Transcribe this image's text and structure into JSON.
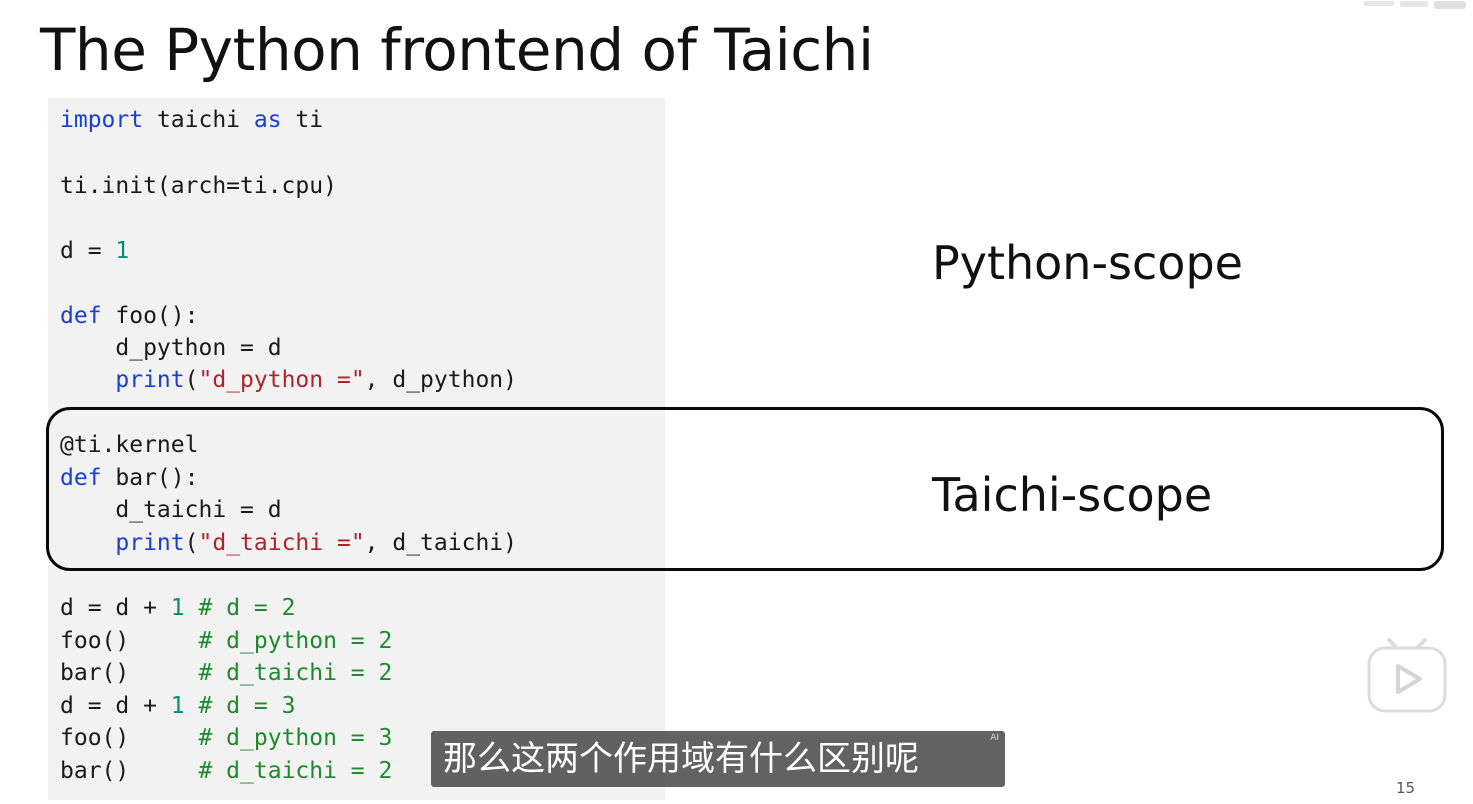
{
  "slide": {
    "title": "The Python frontend of Taichi",
    "page_number": "15"
  },
  "code": {
    "l1": {
      "kw1": "import",
      "t1": " taichi ",
      "kw2": "as",
      "t2": " ti"
    },
    "l2": {
      "t1": "ti.init(arch=ti.cpu)"
    },
    "l3": {
      "t1": "d = ",
      "n1": "1"
    },
    "l4": {
      "kw1": "def",
      "t1": " foo():"
    },
    "l5": {
      "t1": "    d_python = d"
    },
    "l6": {
      "pre": "    ",
      "kw1": "print",
      "t1": "(",
      "s1": "\"d_python =\"",
      "t2": ", d_python)"
    },
    "l7": {
      "t1": "@ti.kernel"
    },
    "l8": {
      "kw1": "def",
      "t1": " bar():"
    },
    "l9": {
      "t1": "    d_taichi = d"
    },
    "l10": {
      "pre": "    ",
      "kw1": "print",
      "t1": "(",
      "s1": "\"d_taichi =\"",
      "t2": ", d_taichi)"
    },
    "l11": {
      "t1": "d = d + ",
      "n1": "1",
      "t2": " ",
      "c1": "# d = 2"
    },
    "l12": {
      "t1": "foo()     ",
      "c1": "# d_python = 2"
    },
    "l13": {
      "t1": "bar()     ",
      "c1": "# d_taichi = 2"
    },
    "l14": {
      "t1": "d = d + ",
      "n1": "1",
      "t2": " ",
      "c1": "# d = 3"
    },
    "l15": {
      "t1": "foo()     ",
      "c1": "# d_python = 3"
    },
    "l16": {
      "t1": "bar()     ",
      "c1": "# d_taichi = 2"
    }
  },
  "labels": {
    "python_scope": "Python-scope",
    "taichi_scope": "Taichi-scope"
  },
  "subtitle": {
    "text": "那么这两个作用域有什么区别呢",
    "ai_badge": "AI"
  },
  "icons": {
    "play": "play-icon",
    "watermark": "bilibili-logo"
  },
  "colors": {
    "keyword": "#1a3ed0",
    "number": "#0a8a78",
    "string": "#b0232a",
    "comment": "#1d8a2b",
    "code_background": "#f2f2f2"
  }
}
